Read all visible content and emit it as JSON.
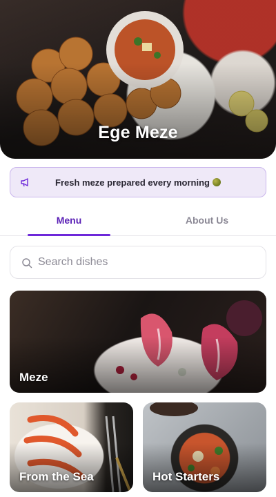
{
  "hero": {
    "title": "Ege Meze"
  },
  "announcement": {
    "text": "Fresh meze prepared every morning",
    "icon": "megaphone-icon"
  },
  "tabs": [
    {
      "label": "Menu",
      "active": true
    },
    {
      "label": "About Us",
      "active": false
    }
  ],
  "search": {
    "placeholder": "Search dishes",
    "value": ""
  },
  "categories": [
    {
      "label": "Meze"
    },
    {
      "label": "From the Sea"
    },
    {
      "label": "Hot Starters"
    }
  ],
  "colors": {
    "accent": "#6d28d9",
    "banner_bg": "#efe9f8",
    "banner_border": "#c9b5ec"
  }
}
